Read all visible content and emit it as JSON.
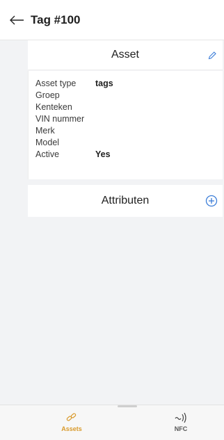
{
  "header": {
    "title": "Tag #100"
  },
  "asset_card": {
    "title": "Asset"
  },
  "details": [
    {
      "label": "Asset type",
      "value": "tags"
    },
    {
      "label": "Groep",
      "value": ""
    },
    {
      "label": "Kenteken",
      "value": ""
    },
    {
      "label": "VIN nummer",
      "value": ""
    },
    {
      "label": "Merk",
      "value": ""
    },
    {
      "label": "Model",
      "value": ""
    },
    {
      "label": "Active",
      "value": "Yes"
    }
  ],
  "attributes_card": {
    "title": "Attributen"
  },
  "bottom_nav": {
    "items": [
      {
        "label": "Assets",
        "icon": "link-icon",
        "active": true
      },
      {
        "label": "NFC",
        "icon": "nfc-icon",
        "active": false
      }
    ]
  },
  "colors": {
    "accent": "#d99a2b",
    "icon_blue": "#3b7dd8"
  }
}
